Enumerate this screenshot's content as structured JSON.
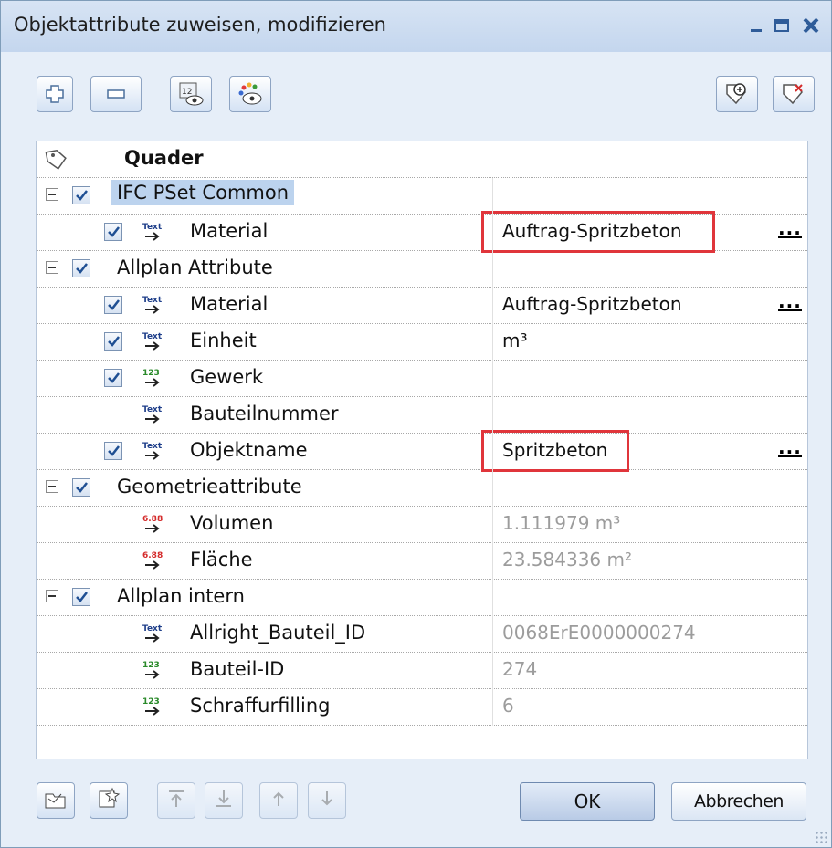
{
  "window": {
    "title": "Objektattribute zuweisen, modifizieren",
    "controls": [
      "minimize-icon",
      "maximize-icon",
      "close-icon"
    ]
  },
  "toolbar": {
    "left_buttons": [
      "add-icon",
      "remove-icon",
      "number-eye-icon",
      "color-eye-icon"
    ],
    "right_buttons": [
      "favorite-add-icon",
      "favorite-remove-icon"
    ]
  },
  "tree": {
    "root_label": "Quader",
    "groups": [
      {
        "label": "IFC PSet Common",
        "checked": true,
        "items": [
          {
            "type": "text",
            "label": "Material",
            "value": "Auftrag-Spritzbeton",
            "checked": true,
            "has_browse": true,
            "highlighted": true
          }
        ]
      },
      {
        "label": "Allplan Attribute",
        "checked": true,
        "items": [
          {
            "type": "text",
            "label": "Material",
            "value": "Auftrag-Spritzbeton",
            "checked": true,
            "has_browse": true
          },
          {
            "type": "text",
            "label": "Einheit",
            "value": "m³",
            "checked": true
          },
          {
            "type": "integer",
            "label": "Gewerk",
            "value": "",
            "checked": true
          },
          {
            "type": "text",
            "label": "Bauteilnummer",
            "value": "",
            "checked": false
          },
          {
            "type": "text",
            "label": "Objektname",
            "value": "Spritzbeton",
            "checked": true,
            "has_browse": true,
            "highlighted": true
          }
        ]
      },
      {
        "label": "Geometrieattribute",
        "checked": true,
        "items": [
          {
            "type": "decimal",
            "label": "Volumen",
            "value": "1.111979 m³",
            "checked": false,
            "readonly": true
          },
          {
            "type": "decimal",
            "label": "Fläche",
            "value": "23.584336 m²",
            "checked": false,
            "readonly": true
          }
        ]
      },
      {
        "label": "Allplan intern",
        "checked": true,
        "items": [
          {
            "type": "text",
            "label": "Allright_Bauteil_ID",
            "value": "0068ErE0000000274",
            "checked": false,
            "readonly": true
          },
          {
            "type": "integer",
            "label": "Bauteil-ID",
            "value": "274",
            "checked": false,
            "readonly": true
          },
          {
            "type": "integer",
            "label": "Schraffurfilling",
            "value": "6",
            "checked": false,
            "readonly": true
          }
        ]
      }
    ],
    "icon_labels": {
      "text": "Text",
      "integer": "123",
      "decimal": "6.88"
    },
    "browse_label": "..."
  },
  "footer": {
    "ok_label": "OK",
    "cancel_label": "Abbrechen",
    "tool_buttons": [
      "open-favorite-icon",
      "save-favorite-icon",
      "move-top-icon",
      "move-bottom-icon",
      "move-up-icon",
      "move-down-icon"
    ]
  },
  "colors": {
    "highlight_border": "#e0353b",
    "selection": "#bcd3ee",
    "readonly_text": "#9c9c9c"
  }
}
